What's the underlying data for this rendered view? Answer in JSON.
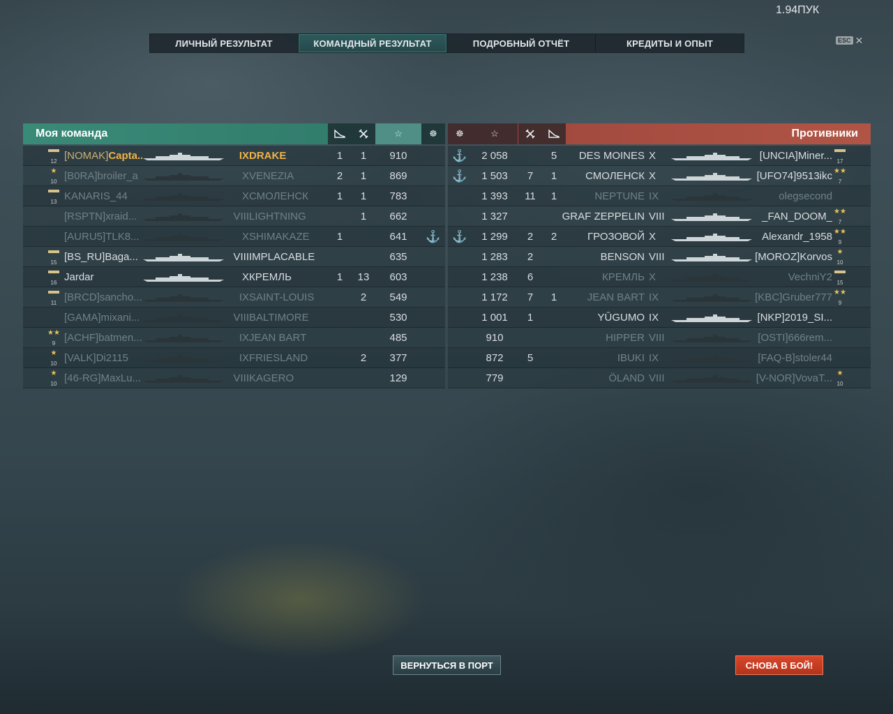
{
  "header": {
    "balance": "1.94ПУК"
  },
  "tabs": [
    "ЛИЧНЫЙ РЕЗУЛЬТАТ",
    "КОМАНДНЫЙ РЕЗУЛЬТАТ",
    "ПОДРОБНЫЙ ОТЧЁТ",
    "КРЕДИТЫ И ОПЫТ"
  ],
  "active_tab": 1,
  "close": {
    "key": "ESC",
    "icon": "close-icon"
  },
  "my_team": {
    "title": "Моя команда",
    "columns": [
      "ships-destroyed-icon",
      "planes-destroyed-icon",
      "star-icon",
      "kill-medal-icon"
    ],
    "rows": [
      {
        "rank": "12",
        "clan": "[NOMAK]",
        "name": "Capta...",
        "tier": "IX",
        "ship": "DRAKE",
        "kills": "1",
        "planes": "1",
        "score": "910",
        "medal": "",
        "alive": true,
        "me": true
      },
      {
        "rank": "10",
        "clan": "[B0RA]",
        "name": "broiler_a",
        "tier": "X",
        "ship": "VENEZIA",
        "kills": "2",
        "planes": "1",
        "score": "869",
        "medal": "",
        "alive": false
      },
      {
        "rank": "13",
        "clan": "",
        "name": "KANARIS_44",
        "tier": "X",
        "ship": "СМОЛЕНСК",
        "kills": "1",
        "planes": "1",
        "score": "783",
        "medal": "",
        "alive": false
      },
      {
        "rank": "",
        "clan": "[RSPTN]",
        "name": "xraid...",
        "tier": "VIII",
        "ship": "LIGHTNING",
        "kills": "",
        "planes": "1",
        "score": "662",
        "medal": "",
        "alive": false
      },
      {
        "rank": "",
        "clan": "[AURU5]",
        "name": "TLK8...",
        "tier": "X",
        "ship": "SHIMAKAZE",
        "kills": "1",
        "planes": "",
        "score": "641",
        "medal": "⚓",
        "alive": false
      },
      {
        "rank": "15",
        "clan": "[BS_RU]",
        "name": "Baga...",
        "tier": "VIII",
        "ship": "IMPLACABLE",
        "kills": "",
        "planes": "",
        "score": "635",
        "medal": "",
        "alive": true
      },
      {
        "rank": "16",
        "clan": "",
        "name": "Jardar",
        "tier": "X",
        "ship": "КРЕМЛЬ",
        "kills": "1",
        "planes": "13",
        "score": "603",
        "medal": "",
        "alive": true
      },
      {
        "rank": "11",
        "clan": "[BRCD]",
        "name": "sancho...",
        "tier": "IX",
        "ship": "SAINT-LOUIS",
        "kills": "",
        "planes": "2",
        "score": "549",
        "medal": "",
        "alive": false
      },
      {
        "rank": "",
        "clan": "[GAMA]",
        "name": "mixani...",
        "tier": "VIII",
        "ship": "BALTIMORE",
        "kills": "",
        "planes": "",
        "score": "530",
        "medal": "",
        "alive": false
      },
      {
        "rank": "9",
        "clan": "[ACHF]",
        "name": "batmen...",
        "tier": "IX",
        "ship": "JEAN BART",
        "kills": "",
        "planes": "",
        "score": "485",
        "medal": "",
        "alive": false
      },
      {
        "rank": "10",
        "clan": "[VALK]",
        "name": "Di2115",
        "tier": "IX",
        "ship": "FRIESLAND",
        "kills": "",
        "planes": "2",
        "score": "377",
        "medal": "",
        "alive": false
      },
      {
        "rank": "10",
        "clan": "[46-RG]",
        "name": "MaxLu...",
        "tier": "VIII",
        "ship": "KAGERO",
        "kills": "",
        "planes": "",
        "score": "129",
        "medal": "",
        "alive": false
      }
    ]
  },
  "enemy_team": {
    "title": "Противники",
    "rows": [
      {
        "medal": "⚓",
        "score": "2 058",
        "planes": "",
        "kills": "5",
        "ship": "DES MOINES",
        "tier": "X",
        "clan": "[UNCIA]",
        "name": "Miner...",
        "rank": "17",
        "alive": true
      },
      {
        "medal": "⚓",
        "score": "1 503",
        "planes": "7",
        "kills": "1",
        "ship": "СМОЛЕНСК",
        "tier": "X",
        "clan": "[UFO74]",
        "name": "9513ikc",
        "rank": "7",
        "alive": true
      },
      {
        "medal": "",
        "score": "1 393",
        "planes": "11",
        "kills": "1",
        "ship": "NEPTUNE",
        "tier": "IX",
        "clan": "",
        "name": "olegsecond",
        "rank": "",
        "alive": false
      },
      {
        "medal": "",
        "score": "1 327",
        "planes": "",
        "kills": "",
        "ship": "GRAF ZEPPELIN",
        "tier": "VIII",
        "clan": "",
        "name": "_FAN_DOOM_",
        "rank": "7",
        "alive": true
      },
      {
        "medal": "⚓",
        "score": "1 299",
        "planes": "2",
        "kills": "2",
        "ship": "ГРОЗОВОЙ",
        "tier": "X",
        "clan": "",
        "name": "Alexandr_1958",
        "rank": "9",
        "alive": true
      },
      {
        "medal": "",
        "score": "1 283",
        "planes": "2",
        "kills": "",
        "ship": "BENSON",
        "tier": "VIII",
        "clan": "[MOROZ]",
        "name": "Korvos",
        "rank": "10",
        "alive": true
      },
      {
        "medal": "",
        "score": "1 238",
        "planes": "6",
        "kills": "",
        "ship": "КРЕМЛЬ",
        "tier": "X",
        "clan": "",
        "name": "VechniY2",
        "rank": "15",
        "alive": false
      },
      {
        "medal": "",
        "score": "1 172",
        "planes": "7",
        "kills": "1",
        "ship": "JEAN BART",
        "tier": "IX",
        "clan": "[KBC]",
        "name": "Gruber777",
        "rank": "9",
        "alive": false
      },
      {
        "medal": "",
        "score": "1 001",
        "planes": "1",
        "kills": "",
        "ship": "YŪGUMO",
        "tier": "IX",
        "clan": "[NKP]",
        "name": "2019_SI...",
        "rank": "",
        "alive": true
      },
      {
        "medal": "",
        "score": "910",
        "planes": "",
        "kills": "",
        "ship": "HIPPER",
        "tier": "VIII",
        "clan": "[OSTI]",
        "name": "666rem...",
        "rank": "",
        "alive": false
      },
      {
        "medal": "",
        "score": "872",
        "planes": "5",
        "kills": "",
        "ship": "IBUKI",
        "tier": "IX",
        "clan": "[FAQ-B]",
        "name": "stoler44",
        "rank": "",
        "alive": false
      },
      {
        "medal": "",
        "score": "779",
        "planes": "",
        "kills": "",
        "ship": "ÖLAND",
        "tier": "VIII",
        "clan": "[V-NOR]",
        "name": "VovaT...",
        "rank": "10",
        "alive": false
      }
    ]
  },
  "buttons": {
    "port": "ВЕРНУТЬСЯ В ПОРТ",
    "battle": "СНОВА В БОЙ!"
  },
  "colors": {
    "ally_header": "#3a8a78",
    "enemy_header": "#b05546",
    "active_tab": "#2e5a5c",
    "self_name": "#f0b347",
    "battle_button": "#d9472b"
  }
}
